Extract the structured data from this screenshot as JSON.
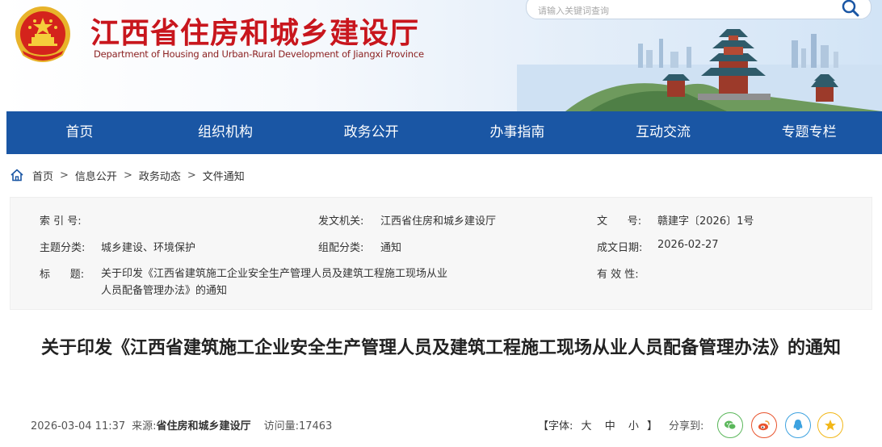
{
  "header": {
    "title": "江西省住房和城乡建设厅",
    "subtitle": "Department of Housing and Urban-Rural Development of Jiangxi Province",
    "search_placeholder": "请输入关键词查询"
  },
  "nav": {
    "items": [
      "首页",
      "组织机构",
      "政务公开",
      "办事指南",
      "互动交流",
      "专题专栏"
    ]
  },
  "breadcrumb": {
    "items": [
      "首页",
      "信息公开",
      "政务动态",
      "文件通知"
    ],
    "separator": ">"
  },
  "info": {
    "index_label": "索 引 号:",
    "index_value": "",
    "issuer_label": "发文机关:",
    "issuer_value": "江西省住房和城乡建设厅",
    "docno_label": "文      号:",
    "docno_value": "赣建字〔2026〕1号",
    "topic_label": "主题分类:",
    "topic_value": "城乡建设、环境保护",
    "category_label": "组配分类:",
    "category_value": "通知",
    "date_label": "成文日期:",
    "date_value": "2026-02-27",
    "title_label": "标      题:",
    "title_value": "关于印发《江西省建筑施工企业安全生产管理人员及建筑工程施工现场从业人员配备管理办法》的通知",
    "validity_label": "有 效 性:",
    "validity_value": ""
  },
  "article": {
    "title": "关于印发《江西省建筑施工企业安全生产管理人员及建筑工程施工现场从业人员配备管理办法》的通知",
    "publish_time": "2026-03-04 11:37",
    "source_label": "来源:",
    "source_value": "省住房和城乡建设厅",
    "visits_label": "访问量:",
    "visits_value": "17463",
    "font_open": "【字体:",
    "font_large": "大",
    "font_medium": "中",
    "font_small": "小",
    "font_close": "】",
    "share_label": "分享到:"
  },
  "share": {
    "icons": [
      "wechat-icon",
      "weibo-icon",
      "qq-icon",
      "qzone-icon"
    ],
    "colors": [
      "#5bb75b",
      "#e8532d",
      "#3da2e0",
      "#f2b718"
    ]
  },
  "colors": {
    "brand_red": "#c8161d",
    "nav_blue": "#1a56a4"
  }
}
